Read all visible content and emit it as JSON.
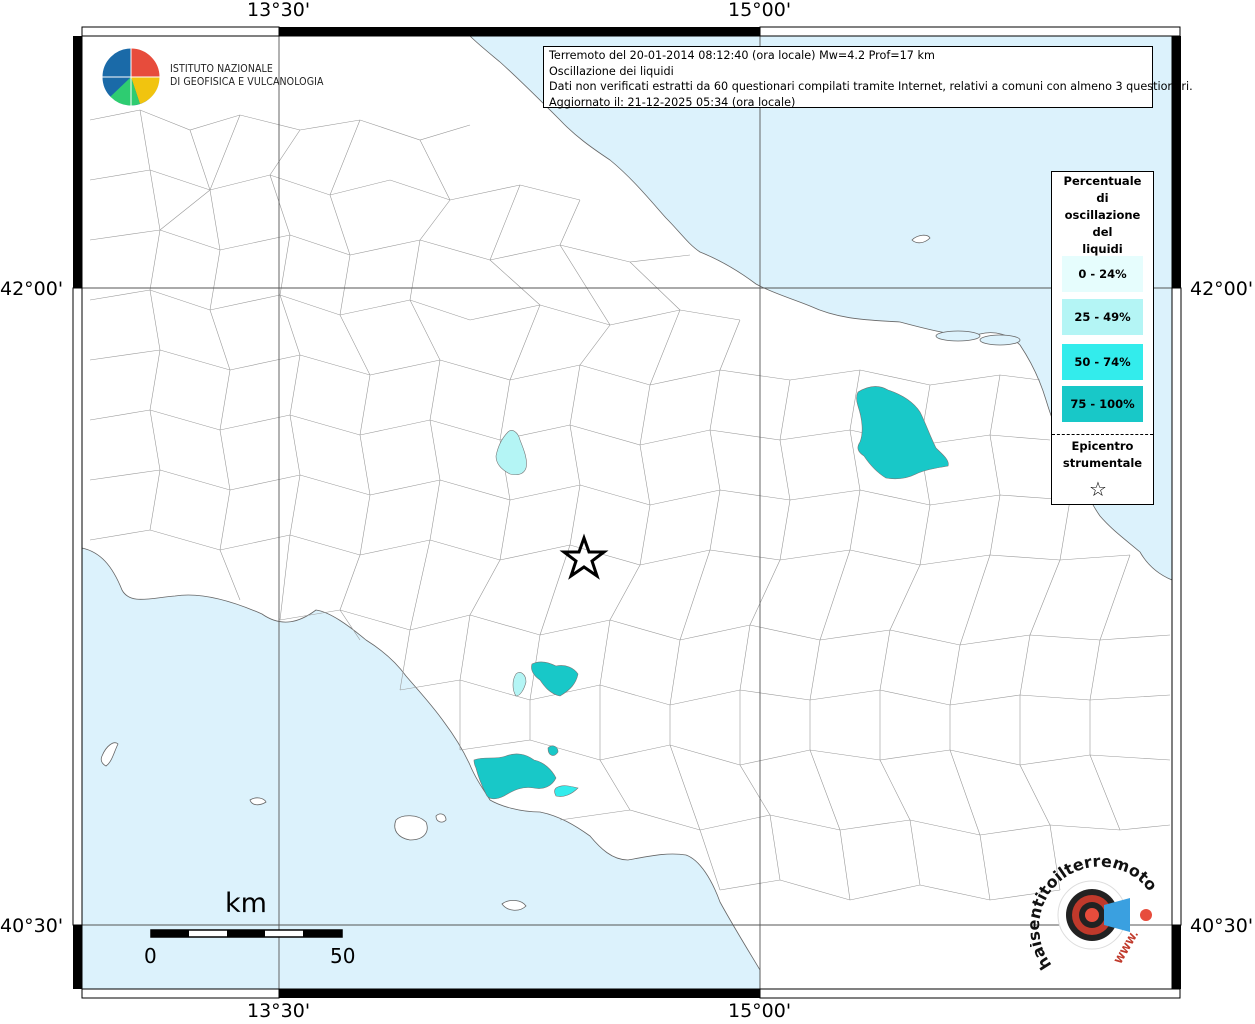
{
  "header_info": {
    "line1": "Terremoto del 20-01-2014 08:12:40 (ora locale) Mw=4.2 Prof=17 km",
    "line2": "Oscillazione dei liquidi",
    "line3": "Dati non verificati estratti da 60 questionari compilati tramite Internet, relativi a comuni con almeno 3 questionari.",
    "line4": "Aggiornato il: 21-12-2025 05:34 (ora locale)"
  },
  "coords": {
    "top_left": "13°30'",
    "top_right": "15°00'",
    "bottom_left": "13°30'",
    "bottom_right": "15°00'",
    "left_upper": "42°00'",
    "left_lower": "40°30'",
    "right_upper": "42°00'",
    "right_lower": "40°30'"
  },
  "legend": {
    "title": [
      "Percentuale",
      "di",
      "oscillazione",
      "del",
      "liquidi"
    ],
    "classes": [
      {
        "label": "0 - 24%",
        "color": "#e6fdfd"
      },
      {
        "label": "25 - 49%",
        "color": "#b4f5f5"
      },
      {
        "label": "50 - 74%",
        "color": "#33ecec"
      },
      {
        "label": "75 - 100%",
        "color": "#18c8c8"
      }
    ],
    "epicenter_line1": "Epicentro",
    "epicenter_line2": "strumentale",
    "star_icon": "star-icon"
  },
  "logo_ingv": {
    "line1": "ISTITUTO NAZIONALE",
    "line2": "DI GEOFISICA E VULCANOLOGIA"
  },
  "scale": {
    "unit": "km",
    "min": "0",
    "max": "50"
  },
  "logo_hsi": {
    "text": "haisentitoilterremoto.it",
    "www": "WWW."
  },
  "colors": {
    "sea": "#dcf2fc",
    "land": "#ffffff",
    "class_75_100": "#18c8c8",
    "class_50_74": "#33ecec",
    "class_25_49": "#b4f5f5"
  }
}
